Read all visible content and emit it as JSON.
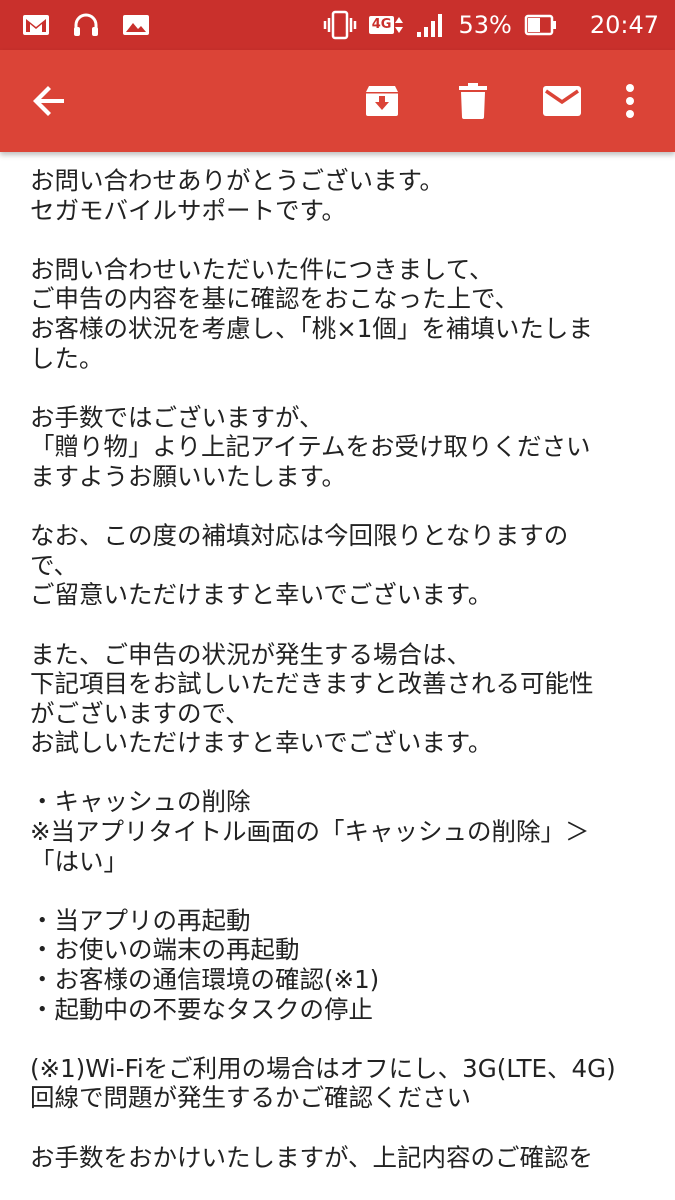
{
  "status_bar": {
    "icons": [
      "gmail-icon",
      "headphones-icon",
      "gallery-icon"
    ],
    "vibrate_icon": "vibrate-icon",
    "network_label": "4G",
    "signal_icon": "signal-icon",
    "battery_percent": "53%",
    "battery_icon": "battery-icon",
    "time": "20:47",
    "bar_color": "#c9302c"
  },
  "app_bar": {
    "color": "#db4437",
    "actions": [
      "back-arrow-icon",
      "archive-icon",
      "delete-icon",
      "mail-icon",
      "more-vert-icon"
    ]
  },
  "email": {
    "lines": [
      "お問い合わせありがとうございます。",
      "セガモバイルサポートです。",
      "",
      "お問い合わせいただいた件につきまして、",
      "ご申告の内容を基に確認をおこなった上で、",
      "お客様の状況を考慮し、「桃×1個」を補填いたしま",
      "した。",
      "",
      "お手数ではございますが、",
      "「贈り物」より上記アイテムをお受け取りください",
      "ますようお願いいたします。",
      "",
      "なお、この度の補填対応は今回限りとなりますの",
      "で、",
      "ご留意いただけますと幸いでございます。",
      "",
      "また、ご申告の状況が発生する場合は、",
      "下記項目をお試しいただきますと改善される可能性",
      "がございますので、",
      "お試しいただけますと幸いでございます。",
      "",
      "・キャッシュの削除",
      "※当アプリタイトル画面の「キャッシュの削除」＞",
      "「はい」",
      "",
      "・当アプリの再起動",
      "・お使いの端末の再起動",
      "・お客様の通信環境の確認(※1)",
      "・起動中の不要なタスクの停止",
      "",
      "(※1)Wi-Fiをご利用の場合はオフにし、3G(LTE、4G)",
      "回線で問題が発生するかご確認ください",
      "",
      "お手数をおかけいたしますが、上記内容のご確認を"
    ]
  }
}
